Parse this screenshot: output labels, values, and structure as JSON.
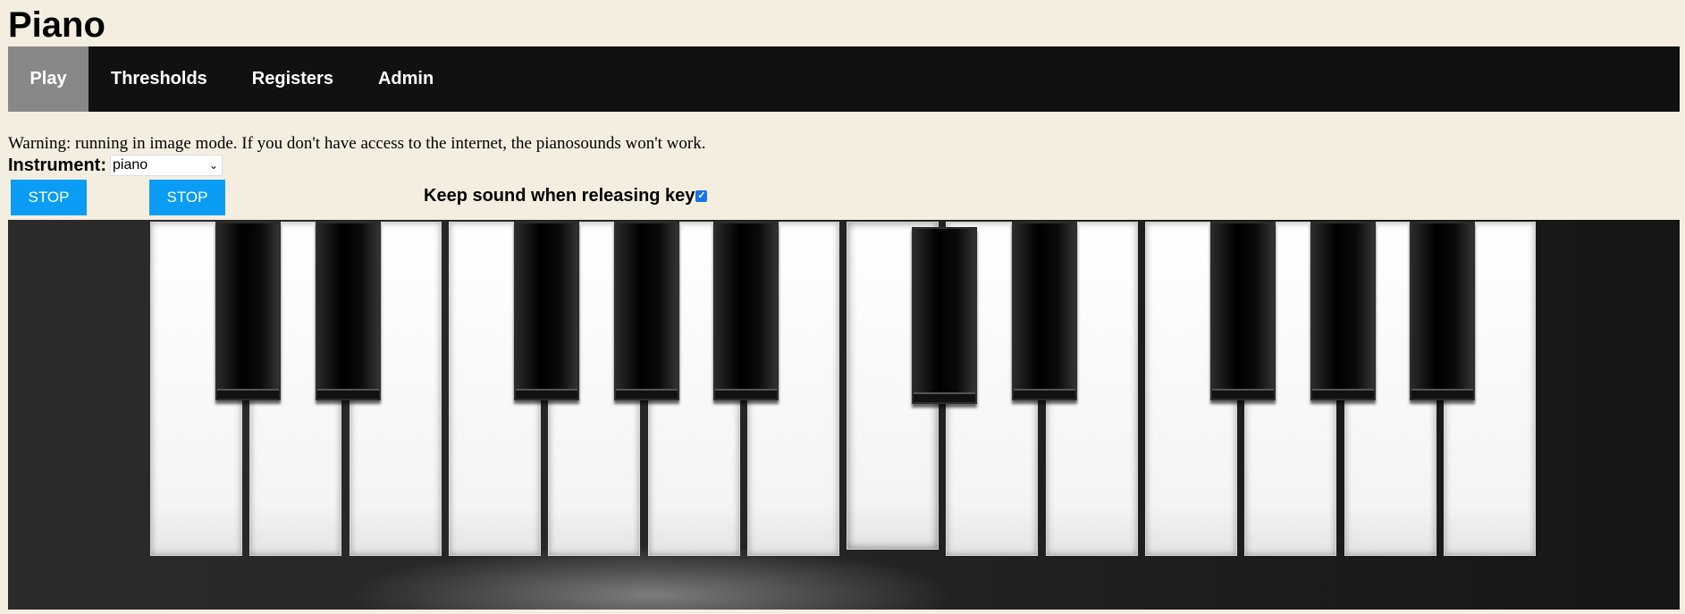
{
  "page": {
    "title": "Piano"
  },
  "nav": {
    "items": [
      {
        "label": "Play",
        "active": true
      },
      {
        "label": "Thresholds",
        "active": false
      },
      {
        "label": "Registers",
        "active": false
      },
      {
        "label": "Admin",
        "active": false
      }
    ]
  },
  "warning": {
    "text": "Warning: running in image mode. If you don't have access to the internet, the pianosounds won't work."
  },
  "instrument": {
    "label": "Instrument:",
    "selected": "piano"
  },
  "controls": {
    "stop_label_1": "STOP",
    "stop_label_2": "STOP",
    "keep_sound_label": "Keep sound when releasing key",
    "keep_sound_checked": true
  },
  "piano": {
    "white_key_count": 14,
    "black_key_count": 10,
    "pressed_white_key_index": 7,
    "pressed_black_key_index": 5
  },
  "colors": {
    "background": "#f3eedf",
    "nav_bg": "#111111",
    "nav_active": "#888888",
    "button": "#0b9cf6"
  },
  "icons": {
    "select_chevron": "chevron-down-icon",
    "checkbox": "checkbox-checked-icon"
  }
}
